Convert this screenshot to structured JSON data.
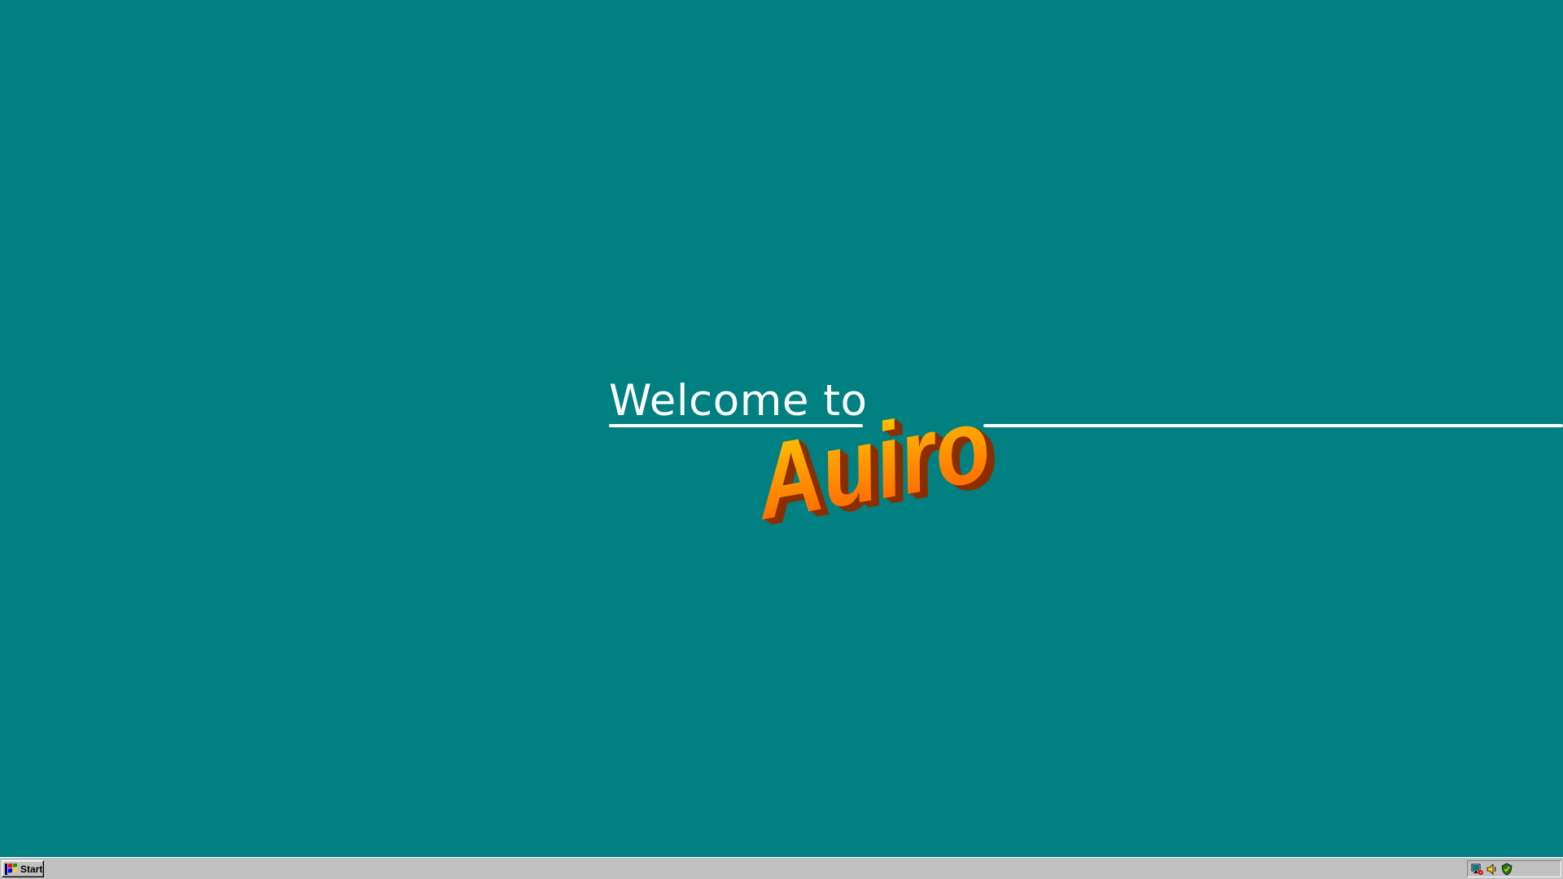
{
  "desktop": {
    "background_color": "#008080",
    "welcome": {
      "prefix": "Welcome to",
      "brand": "Auiro"
    }
  },
  "taskbar": {
    "start_label": "Start",
    "start_icon": "windows-logo-icon",
    "tray_icons": [
      "network-icon",
      "volume-icon",
      "antivirus-icon"
    ]
  },
  "colors": {
    "desktop": "#008080",
    "taskbar": "#c0c0c0",
    "logo_gradient_top": "#ffd000",
    "logo_gradient_bottom": "#ff5a00",
    "logo_shadow": "#8a2e00"
  }
}
